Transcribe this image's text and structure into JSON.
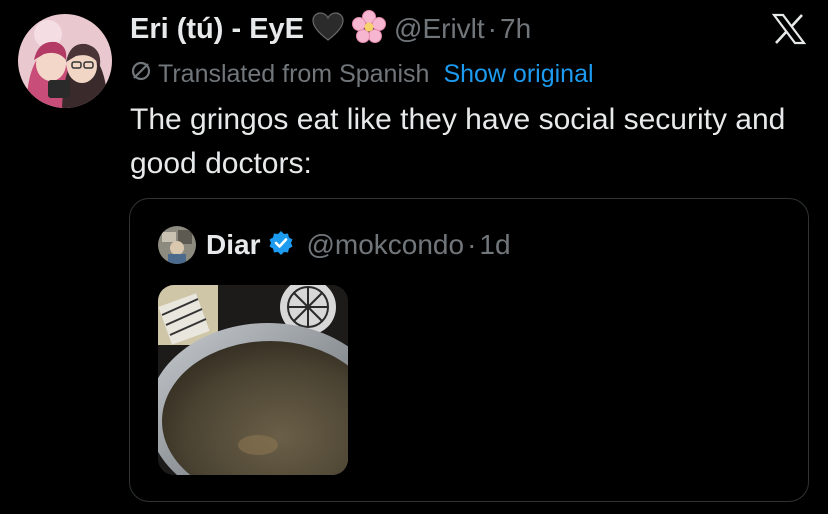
{
  "tweet": {
    "author_name": "Eri (tú) - EyE",
    "emojis": [
      "black-heart-icon",
      "cherry-blossom-icon"
    ],
    "handle": "@Erivlt",
    "separator": "·",
    "time": "7h",
    "translated_label": "Translated from Spanish",
    "show_original_label": "Show original",
    "text": "The gringos eat like they have social security and good doctors:"
  },
  "quoted_tweet": {
    "author_name": "Diar",
    "verified": true,
    "handle": "@mokcondo",
    "separator": "·",
    "time": "1d",
    "media": "photo-thumbnail"
  },
  "colors": {
    "background": "#000000",
    "text_primary": "#e7e9ea",
    "text_secondary": "#71767b",
    "link": "#1d9bf0",
    "border": "#2f3336",
    "verified_badge": "#1d9bf0"
  }
}
